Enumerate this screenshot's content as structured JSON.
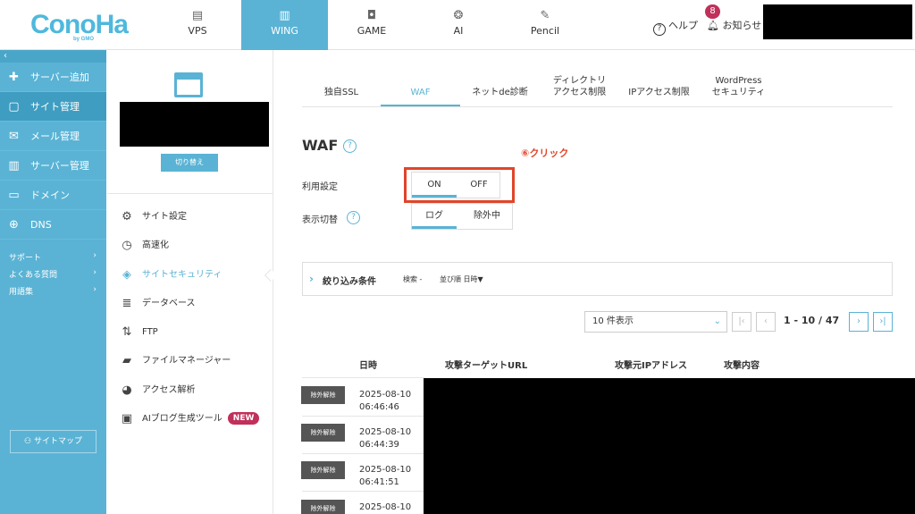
{
  "header": {
    "logo": "ConoHa",
    "logo_sub": "by GMO",
    "nav": [
      {
        "label": "VPS",
        "icon": "server-icon"
      },
      {
        "label": "WING",
        "icon": "wing-icon"
      },
      {
        "label": "GAME",
        "icon": "gamepad-icon"
      },
      {
        "label": "AI",
        "icon": "brain-icon"
      },
      {
        "label": "Pencil",
        "icon": "pencil-icon"
      }
    ],
    "help": "ヘルプ",
    "notice": "お知らせ",
    "notice_count": "8"
  },
  "sidebar": {
    "collapse": "‹",
    "items": [
      {
        "label": "サーバー追加",
        "icon": "plus-icon"
      },
      {
        "label": "サイト管理",
        "icon": "window-icon"
      },
      {
        "label": "メール管理",
        "icon": "mail-icon"
      },
      {
        "label": "サーバー管理",
        "icon": "server-icon"
      },
      {
        "label": "ドメイン",
        "icon": "domain-icon"
      },
      {
        "label": "DNS",
        "icon": "globe-icon"
      }
    ],
    "links": [
      "サポート",
      "よくある質問",
      "用語集"
    ],
    "sitemap": "サイトマップ"
  },
  "site_panel": {
    "switch": "切り替え",
    "menu": [
      {
        "label": "サイト設定",
        "icon": "settings-icon"
      },
      {
        "label": "高速化",
        "icon": "stopwatch-icon"
      },
      {
        "label": "サイトセキュリティ",
        "icon": "shield-icon"
      },
      {
        "label": "データベース",
        "icon": "database-icon"
      },
      {
        "label": "FTP",
        "icon": "transfer-icon"
      },
      {
        "label": "ファイルマネージャー",
        "icon": "folder-icon"
      },
      {
        "label": "アクセス解析",
        "icon": "pie-chart-icon"
      },
      {
        "label": "AIブログ生成ツール",
        "icon": "ai-blog-icon"
      }
    ],
    "new_badge": "NEW"
  },
  "tabs": [
    {
      "label": "独自SSL"
    },
    {
      "label": "WAF"
    },
    {
      "label": "ネットde診断"
    },
    {
      "label": "ディレクトリ\nアクセス制限"
    },
    {
      "label": "IPアクセス制限"
    },
    {
      "label": "WordPress\nセキュリティ"
    }
  ],
  "waf": {
    "title": "WAF",
    "annotation": "⑥クリック",
    "use_label": "利用設定",
    "on": "ON",
    "off": "OFF",
    "selected_use": "ON",
    "display_label": "表示切替",
    "log": "ログ",
    "excluded": "除外中",
    "selected_display": "ログ"
  },
  "filter": {
    "title": "絞り込み条件",
    "search": "検索 -",
    "sort": "並び順  日時▼"
  },
  "pager": {
    "per_page": "10 件表示",
    "info": "1 - 10 / 47"
  },
  "table": {
    "headers": [
      "日時",
      "攻撃ターゲットURL",
      "攻撃元IPアドレス",
      "攻撃内容"
    ],
    "rows": [
      {
        "action": "除外解除",
        "date": "2025-08-10",
        "time": "06:46:46"
      },
      {
        "action": "除外解除",
        "date": "2025-08-10",
        "time": "06:44:39"
      },
      {
        "action": "除外解除",
        "date": "2025-08-10",
        "time": "06:41:51"
      },
      {
        "action": "除外解除",
        "date": "2025-08-10",
        "time": ""
      }
    ]
  },
  "colors": {
    "accent": "#5ab3d5",
    "annotation": "#e0452a",
    "badge": "#c0305b"
  }
}
